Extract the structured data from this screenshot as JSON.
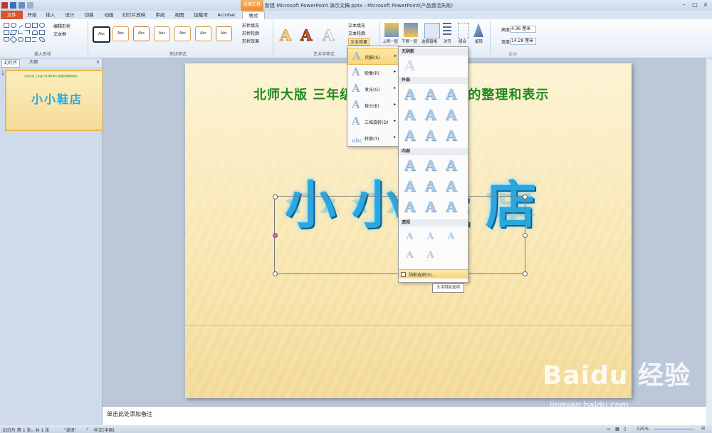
{
  "titlebar": {
    "title": "新建 Microsoft PowerPoint 演示文稿.pptx  -  Microsoft PowerPoint(产品激活失败)",
    "context_group": "绘图工具"
  },
  "tabs": [
    "文件",
    "开始",
    "插入",
    "设计",
    "切换",
    "动画",
    "幻灯片放映",
    "审阅",
    "视图",
    "加载项",
    "Acrobat",
    "格式"
  ],
  "ribbon": {
    "insert_shapes": {
      "edit_shape": "编辑形状",
      "textbox": "文本框",
      "label": "插入形状"
    },
    "shape_styles": {
      "sample": "Abc",
      "fill": "形状填充",
      "outline": "形状轮廓",
      "effects": "形状效果",
      "label": "形状样式"
    },
    "wordart": {
      "text_fill": "文本填充",
      "text_outline": "文本轮廓",
      "text_effects": "文本效果",
      "label": "艺术字样式"
    },
    "arrange": {
      "bring_forward": "上移一层",
      "send_backward": "下移一层",
      "selection_pane": "选择窗格",
      "align": "对齐",
      "group": "组合",
      "rotate": "旋转"
    },
    "size": {
      "height_label": "高度:",
      "height": "4.36 厘米",
      "width_label": "宽度:",
      "width": "14.28 厘米",
      "label": "大小"
    }
  },
  "left_panel": {
    "tab_slides": "幻灯片",
    "tab_outline": "大纲",
    "slide_number": "1",
    "thumb_title": "北师大版 三年级下册 第6单元 数据的整理和表示",
    "thumb_wordart": "小小鞋店"
  },
  "slide": {
    "title": "北师大版  三年级下册  第6单元  数据的整理和表示",
    "wordart": "小小鞋店"
  },
  "text_effects_menu": {
    "items": [
      {
        "label": "阴影(S)",
        "icon": "A"
      },
      {
        "label": "映像(R)",
        "icon": "A"
      },
      {
        "label": "发光(G)",
        "icon": "A"
      },
      {
        "label": "棱台(B)",
        "icon": "A"
      },
      {
        "label": "三维旋转(D)",
        "icon": "A"
      },
      {
        "label": "转换(T)",
        "icon": "abc"
      }
    ]
  },
  "shadow_submenu": {
    "no_shadow": "无阴影",
    "outer": "外部",
    "inner": "内部",
    "perspective": "透视",
    "options": "阴影选项(S)...",
    "glyph": "A"
  },
  "tooltip": "文字阴影选项",
  "notes_placeholder": "单击此处添加备注",
  "statusbar": {
    "slide_info": "幻灯片 第 1 张，共 1 张",
    "theme": "\"波浪\"",
    "language": "中文(中国)",
    "zoom": "125%"
  },
  "watermark": {
    "brand": "Baidu 经验",
    "url": "jingyan.baidu.com"
  }
}
